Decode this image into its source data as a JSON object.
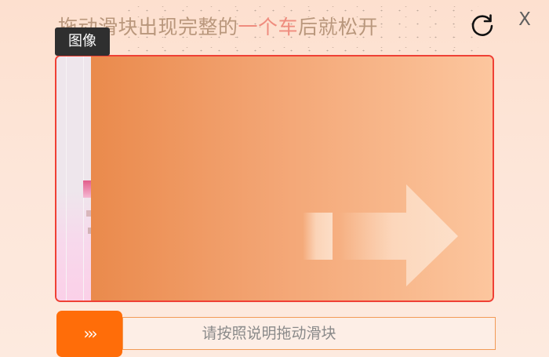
{
  "instruction": {
    "before": "拖动滑块出现完整的",
    "highlight": "一个车",
    "after": "后就松开"
  },
  "tooltip": {
    "label": "图像"
  },
  "refresh": {
    "icon": "refresh-icon"
  },
  "close": {
    "label": "X",
    "icon": "close-icon"
  },
  "puzzle": {
    "icon": "arrow-right-icon",
    "accent_border": "#ef4035"
  },
  "slider": {
    "handle_label": "›››",
    "placeholder": "请按照说明拖动滑块",
    "handle_color": "#ff6d09"
  }
}
